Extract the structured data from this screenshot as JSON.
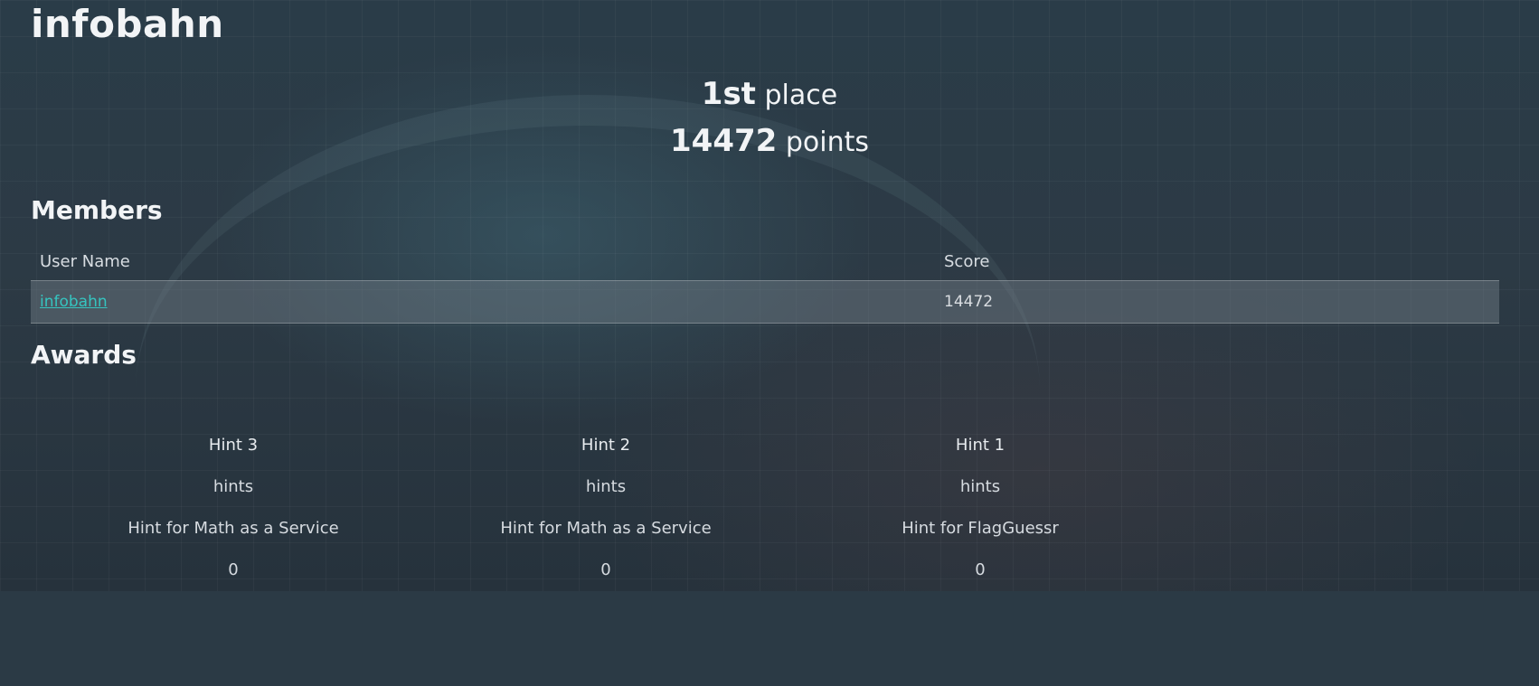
{
  "team": {
    "name": "infobahn",
    "rank_number": "1st",
    "rank_suffix": "place",
    "points_number": "14472",
    "points_suffix": "points"
  },
  "members": {
    "title": "Members",
    "columns": [
      "User Name",
      "Score"
    ],
    "rows": [
      {
        "user": "infobahn",
        "score": "14472"
      }
    ]
  },
  "awards": {
    "title": "Awards",
    "items": [
      {
        "name": "Hint 3",
        "category": "hints",
        "description": "Hint for Math as a Service",
        "value": "0"
      },
      {
        "name": "Hint 2",
        "category": "hints",
        "description": "Hint for Math as a Service",
        "value": "0"
      },
      {
        "name": "Hint 1",
        "category": "hints",
        "description": "Hint for FlagGuessr",
        "value": "0"
      }
    ]
  },
  "colors": {
    "link": "#35c5c0",
    "background": "#2b3a45"
  }
}
